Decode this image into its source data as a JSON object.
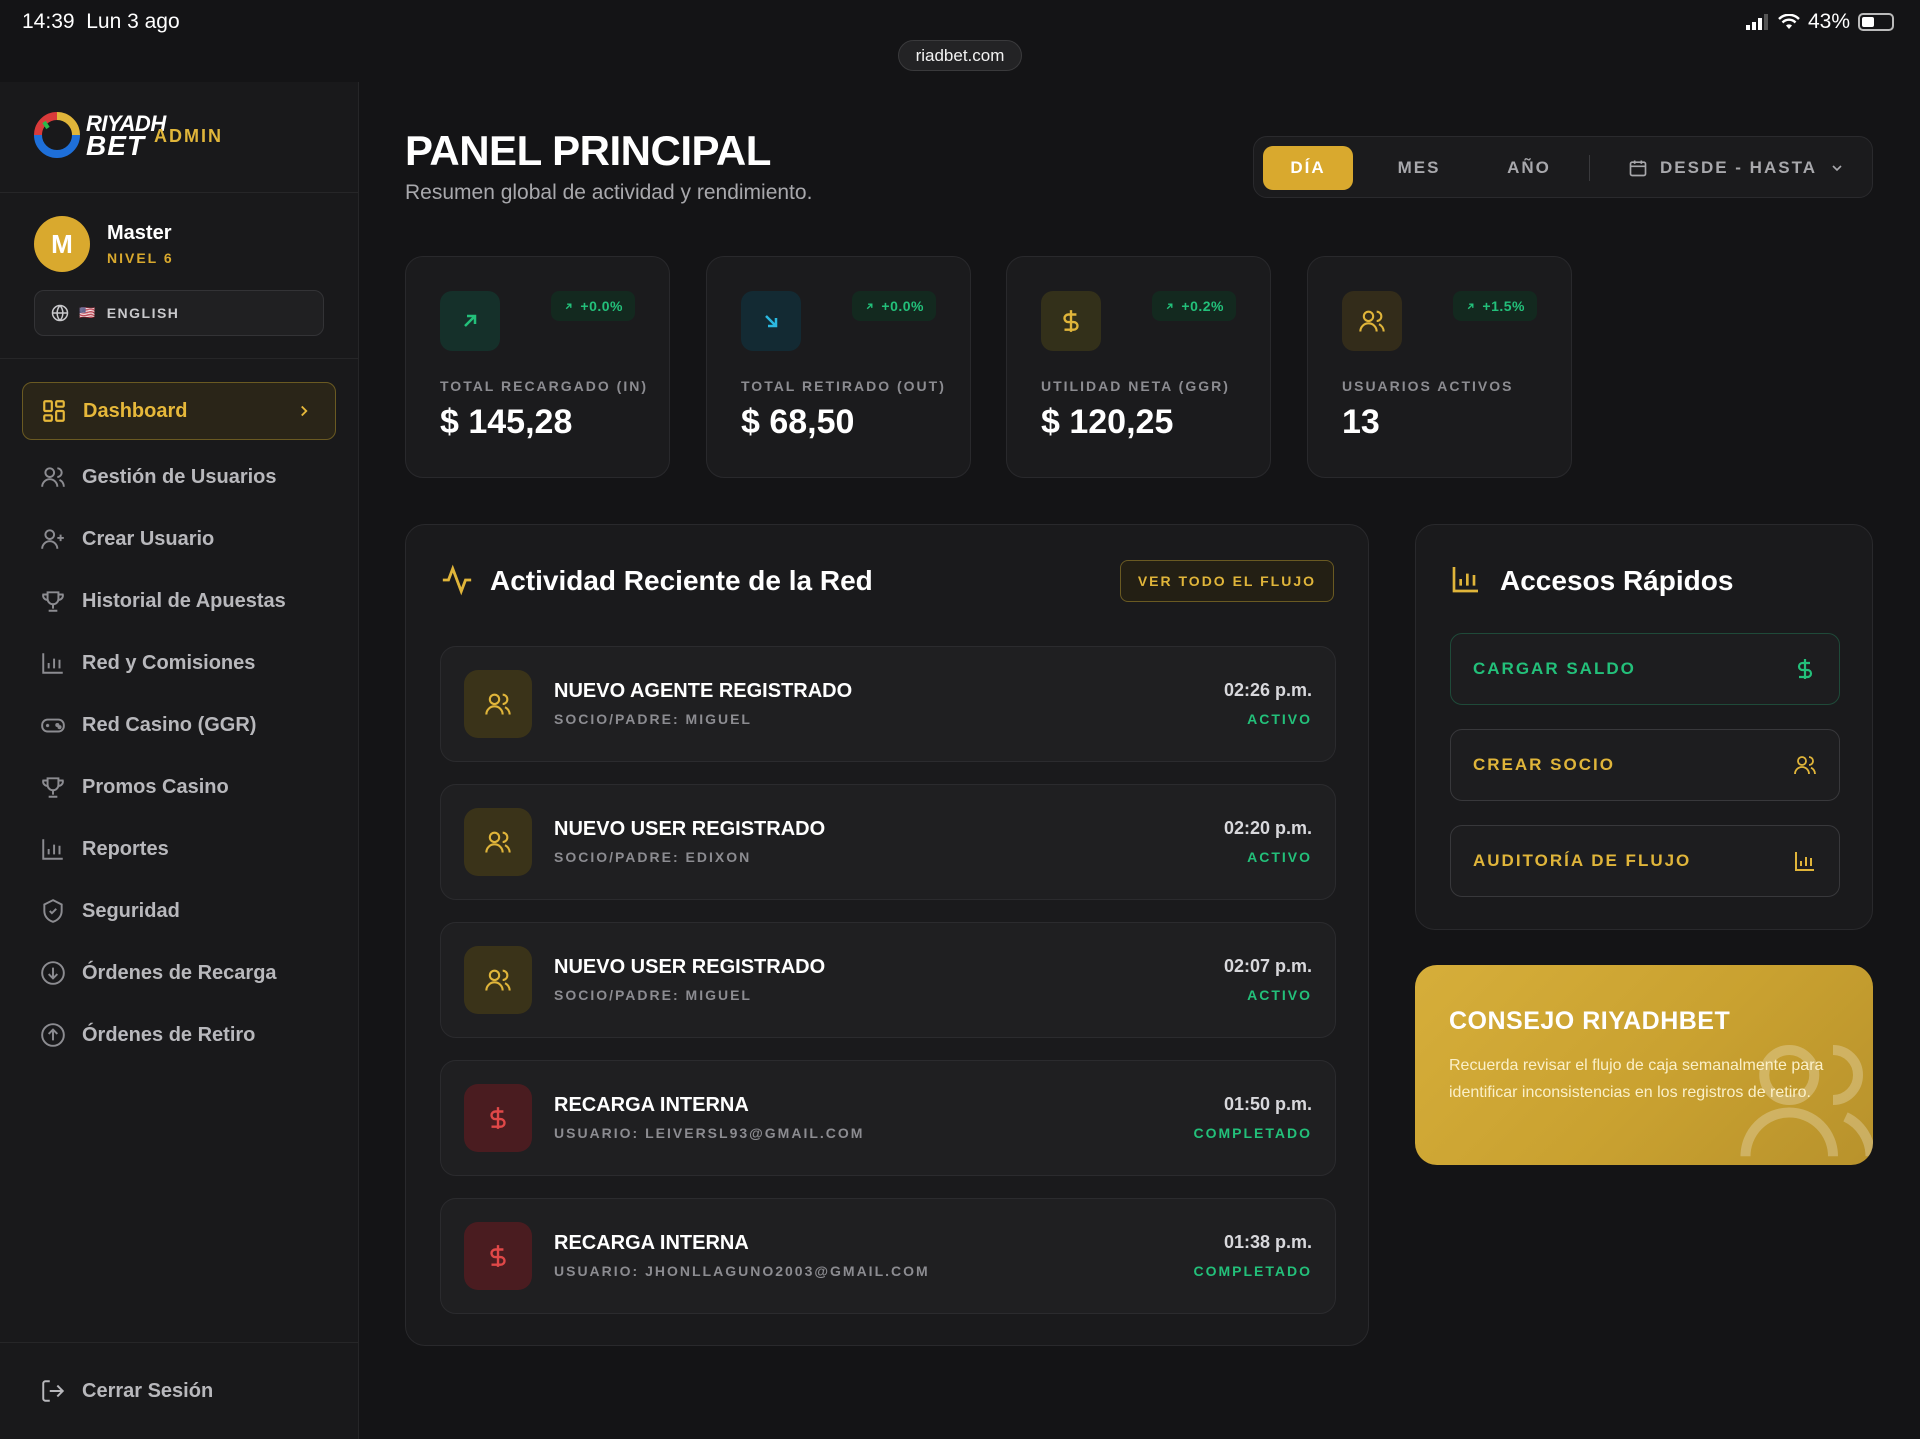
{
  "status_bar": {
    "time": "14:39",
    "date": "Lun 3 ago",
    "battery": "43%",
    "url": "riadbet.com"
  },
  "sidebar": {
    "brand_top": "RIYADH",
    "brand_bottom": "BET",
    "admin_label": "ADMIN",
    "profile": {
      "initial": "M",
      "name": "Master",
      "level": "NIVEL 6"
    },
    "language": "ENGLISH",
    "nav": [
      {
        "label": "Dashboard",
        "icon": "dashboard-icon",
        "active": true
      },
      {
        "label": "Gestión de Usuarios",
        "icon": "users-icon"
      },
      {
        "label": "Crear Usuario",
        "icon": "user-plus-icon"
      },
      {
        "label": "Historial de Apuestas",
        "icon": "trophy-icon"
      },
      {
        "label": "Red y Comisiones",
        "icon": "bar-chart-icon"
      },
      {
        "label": "Red Casino (GGR)",
        "icon": "gamepad-icon"
      },
      {
        "label": "Promos Casino",
        "icon": "trophy-icon"
      },
      {
        "label": "Reportes",
        "icon": "bar-chart-icon"
      },
      {
        "label": "Seguridad",
        "icon": "shield-icon"
      },
      {
        "label": "Órdenes de Recarga",
        "icon": "arrow-down-circle-icon"
      },
      {
        "label": "Órdenes de Retiro",
        "icon": "arrow-up-circle-icon"
      }
    ],
    "logout": "Cerrar Sesión"
  },
  "header": {
    "title": "PANEL PRINCIPAL",
    "subtitle": "Resumen global de actividad y rendimiento.",
    "periods": [
      "DÍA",
      "MES",
      "AÑO"
    ],
    "active_period": "DÍA",
    "range_label": "DESDE - HASTA"
  },
  "stats": [
    {
      "label": "TOTAL RECARGADO (IN)",
      "value": "$ 145,28",
      "change": "+0.0%",
      "icon": "arrow-up-right-icon",
      "color": "#23c07a"
    },
    {
      "label": "TOTAL RETIRADO (OUT)",
      "value": "$ 68,50",
      "change": "+0.0%",
      "icon": "arrow-down-right-icon",
      "color": "#2bb8e0"
    },
    {
      "label": "UTILIDAD NETA (GGR)",
      "value": "$ 120,25",
      "change": "+0.2%",
      "icon": "dollar-icon",
      "color": "#e0b53a"
    },
    {
      "label": "USUARIOS ACTIVOS",
      "value": "13",
      "change": "+1.5%",
      "icon": "users-icon",
      "color": "#e0b53a"
    }
  ],
  "activity": {
    "title": "Actividad Reciente de la Red",
    "button": "VER TODO EL FLUJO",
    "items": [
      {
        "title": "NUEVO AGENTE REGISTRADO",
        "sub": "SOCIO/PADRE: MIGUEL",
        "time": "02:26 p.m.",
        "status": "ACTIVO",
        "kind": "user"
      },
      {
        "title": "NUEVO USER REGISTRADO",
        "sub": "SOCIO/PADRE: EDIXON",
        "time": "02:20 p.m.",
        "status": "ACTIVO",
        "kind": "user"
      },
      {
        "title": "NUEVO USER REGISTRADO",
        "sub": "SOCIO/PADRE: MIGUEL",
        "time": "02:07 p.m.",
        "status": "ACTIVO",
        "kind": "user"
      },
      {
        "title": "RECARGA INTERNA",
        "sub": "USUARIO: LEIVERSL93@GMAIL.COM",
        "time": "01:50 p.m.",
        "status": "COMPLETADO",
        "kind": "money"
      },
      {
        "title": "RECARGA INTERNA",
        "sub": "USUARIO: JHONLLAGUNO2003@GMAIL.COM",
        "time": "01:38 p.m.",
        "status": "COMPLETADO",
        "kind": "money"
      }
    ]
  },
  "quick_access": {
    "title": "Accesos Rápidos",
    "buttons": [
      {
        "label": "CARGAR SALDO",
        "icon": "dollar-icon"
      },
      {
        "label": "CREAR SOCIO",
        "icon": "users-icon"
      },
      {
        "label": "AUDITORÍA DE FLUJO",
        "icon": "bar-chart-icon"
      }
    ]
  },
  "tip": {
    "title": "CONSEJO RIYADHBET",
    "text": "Recuerda revisar el flujo de caja semanalmente para identificar inconsistencias en los registros de retiro."
  },
  "colors": {
    "gold": "#d9a92e",
    "green": "#23c07a",
    "red": "#e04848",
    "cyan": "#2bb8e0"
  }
}
